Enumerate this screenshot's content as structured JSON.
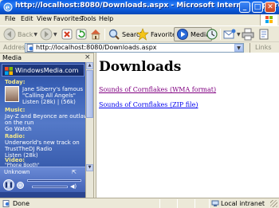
{
  "window": {
    "title": "http://localhost:8080/Downloads.aspx - Microsoft Internet Explorer",
    "minimize_glyph": "_",
    "maximize_glyph": "□",
    "close_glyph": "✕"
  },
  "menu": {
    "items": [
      "File",
      "Edit",
      "View",
      "Favorites",
      "Tools",
      "Help"
    ]
  },
  "toolbar": {
    "back_label": "Back",
    "search_label": "Search",
    "favorites_label": "Favorites",
    "media_label": "Media",
    "icons": [
      "back-icon",
      "forward-icon",
      "stop-icon",
      "refresh-icon",
      "home-icon",
      "search-icon",
      "favorites-icon",
      "media-icon",
      "history-icon",
      "mail-icon",
      "print-icon"
    ]
  },
  "address": {
    "label": "Address",
    "url": "http://localhost:8080/Downloads.aspx",
    "links_label": "Links"
  },
  "media_pane": {
    "header": "Media",
    "close_glyph": "×",
    "banner": "WindowsMedia.com",
    "sections": [
      {
        "label": "Today:",
        "lines": [
          "Jane Siberry's famous",
          "\"Calling All Angels\"",
          "Listen (28k) | (56k)"
        ]
      },
      {
        "label": "Music:",
        "lines": [
          "Jay-Z and Beyonce are outlaws",
          "on the run",
          "Go Watch"
        ]
      },
      {
        "label": "Radio:",
        "lines": [
          "Underworld's new track on",
          "TrustTheDJ Radio",
          "Listen (28k)"
        ]
      },
      {
        "label": "Video:",
        "lines": [
          "\"Phone Booth\""
        ]
      }
    ],
    "player": {
      "title": "Unknown",
      "play_glyph": "❚❚"
    }
  },
  "page": {
    "heading": "Downloads",
    "links": [
      {
        "text": "Sounds of Cornflakes (WMA format)",
        "visited": true
      },
      {
        "text": "Sounds of Cornflakes (ZIP file)",
        "visited": false
      }
    ]
  },
  "status": {
    "text": "Done",
    "zone": "Local intranet"
  },
  "colors": {
    "titlebar": "#0a58d8",
    "chrome": "#ece9d8",
    "media_bg": "#3a62b8",
    "visited_link": "#800080",
    "link": "#0000ee"
  }
}
